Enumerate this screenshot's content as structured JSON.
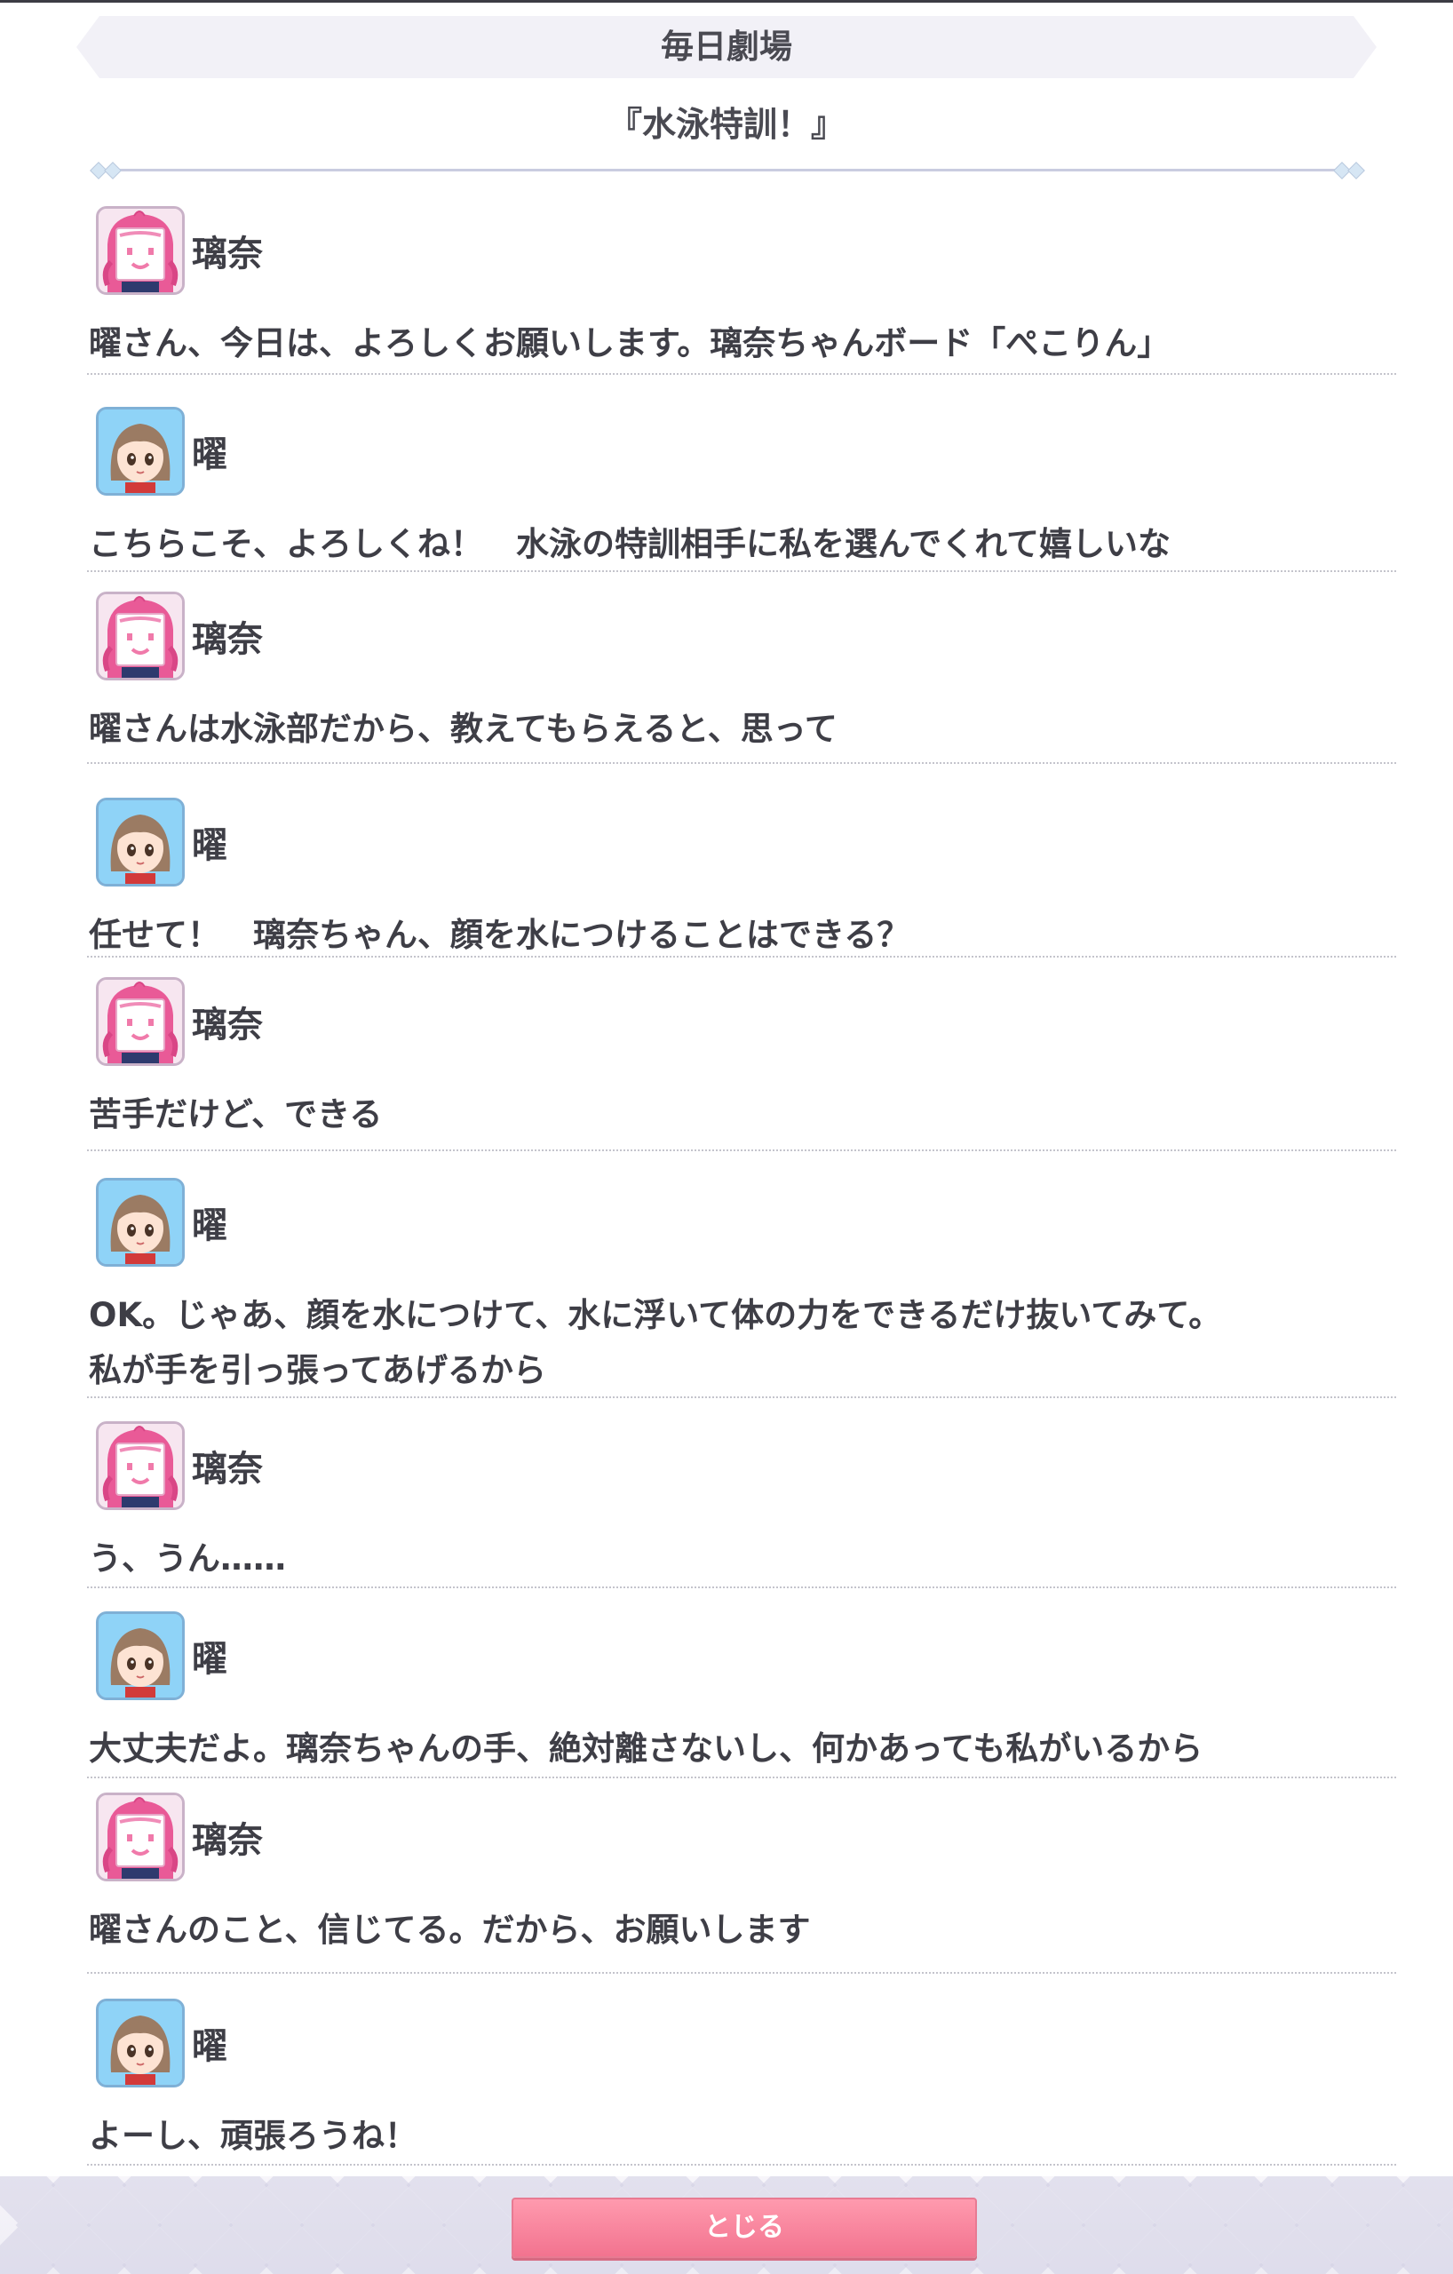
{
  "header": {
    "title": "毎日劇場"
  },
  "episode": {
    "title": "『水泳特訓！』"
  },
  "speakers": {
    "rina": "璃奈",
    "you": "曜"
  },
  "dialogue": [
    {
      "speaker": "璃奈",
      "avatar": "rina-board-face-icon",
      "text": "曜さん、今日は、よろしくお願いします。璃奈ちゃんボード「ぺこりん」"
    },
    {
      "speaker": "曜",
      "avatar": "you-face-icon",
      "text": "こちらこそ、よろしくね！　水泳の特訓相手に私を選んでくれて嬉しいな"
    },
    {
      "speaker": "璃奈",
      "avatar": "rina-board-face-icon",
      "text": "曜さんは水泳部だから、教えてもらえると、思って"
    },
    {
      "speaker": "曜",
      "avatar": "you-face-icon",
      "text": "任せて！　璃奈ちゃん、顔を水につけることはできる？"
    },
    {
      "speaker": "璃奈",
      "avatar": "rina-board-face-icon",
      "text": "苦手だけど、できる"
    },
    {
      "speaker": "曜",
      "avatar": "you-face-icon",
      "text": "OK。じゃあ、顔を水につけて、水に浮いて体の力をできるだけ抜いてみて。\n私が手を引っ張ってあげるから"
    },
    {
      "speaker": "璃奈",
      "avatar": "rina-board-face-icon",
      "text": "う、うん……"
    },
    {
      "speaker": "曜",
      "avatar": "you-face-icon",
      "text": "大丈夫だよ。璃奈ちゃんの手、絶対離さないし、何かあっても私がいるから"
    },
    {
      "speaker": "璃奈",
      "avatar": "rina-board-face-icon",
      "text": "曜さんのこと、信じてる。だから、お願いします"
    },
    {
      "speaker": "曜",
      "avatar": "you-face-icon",
      "text": "よーし、頑張ろうね！"
    }
  ],
  "footer": {
    "close_label": "とじる"
  },
  "colors": {
    "accent": "#f2738f",
    "rina_avatar_bg": "#f7e6f0",
    "you_avatar_bg": "#8fd3f7",
    "divider": "#c4c4cc"
  }
}
